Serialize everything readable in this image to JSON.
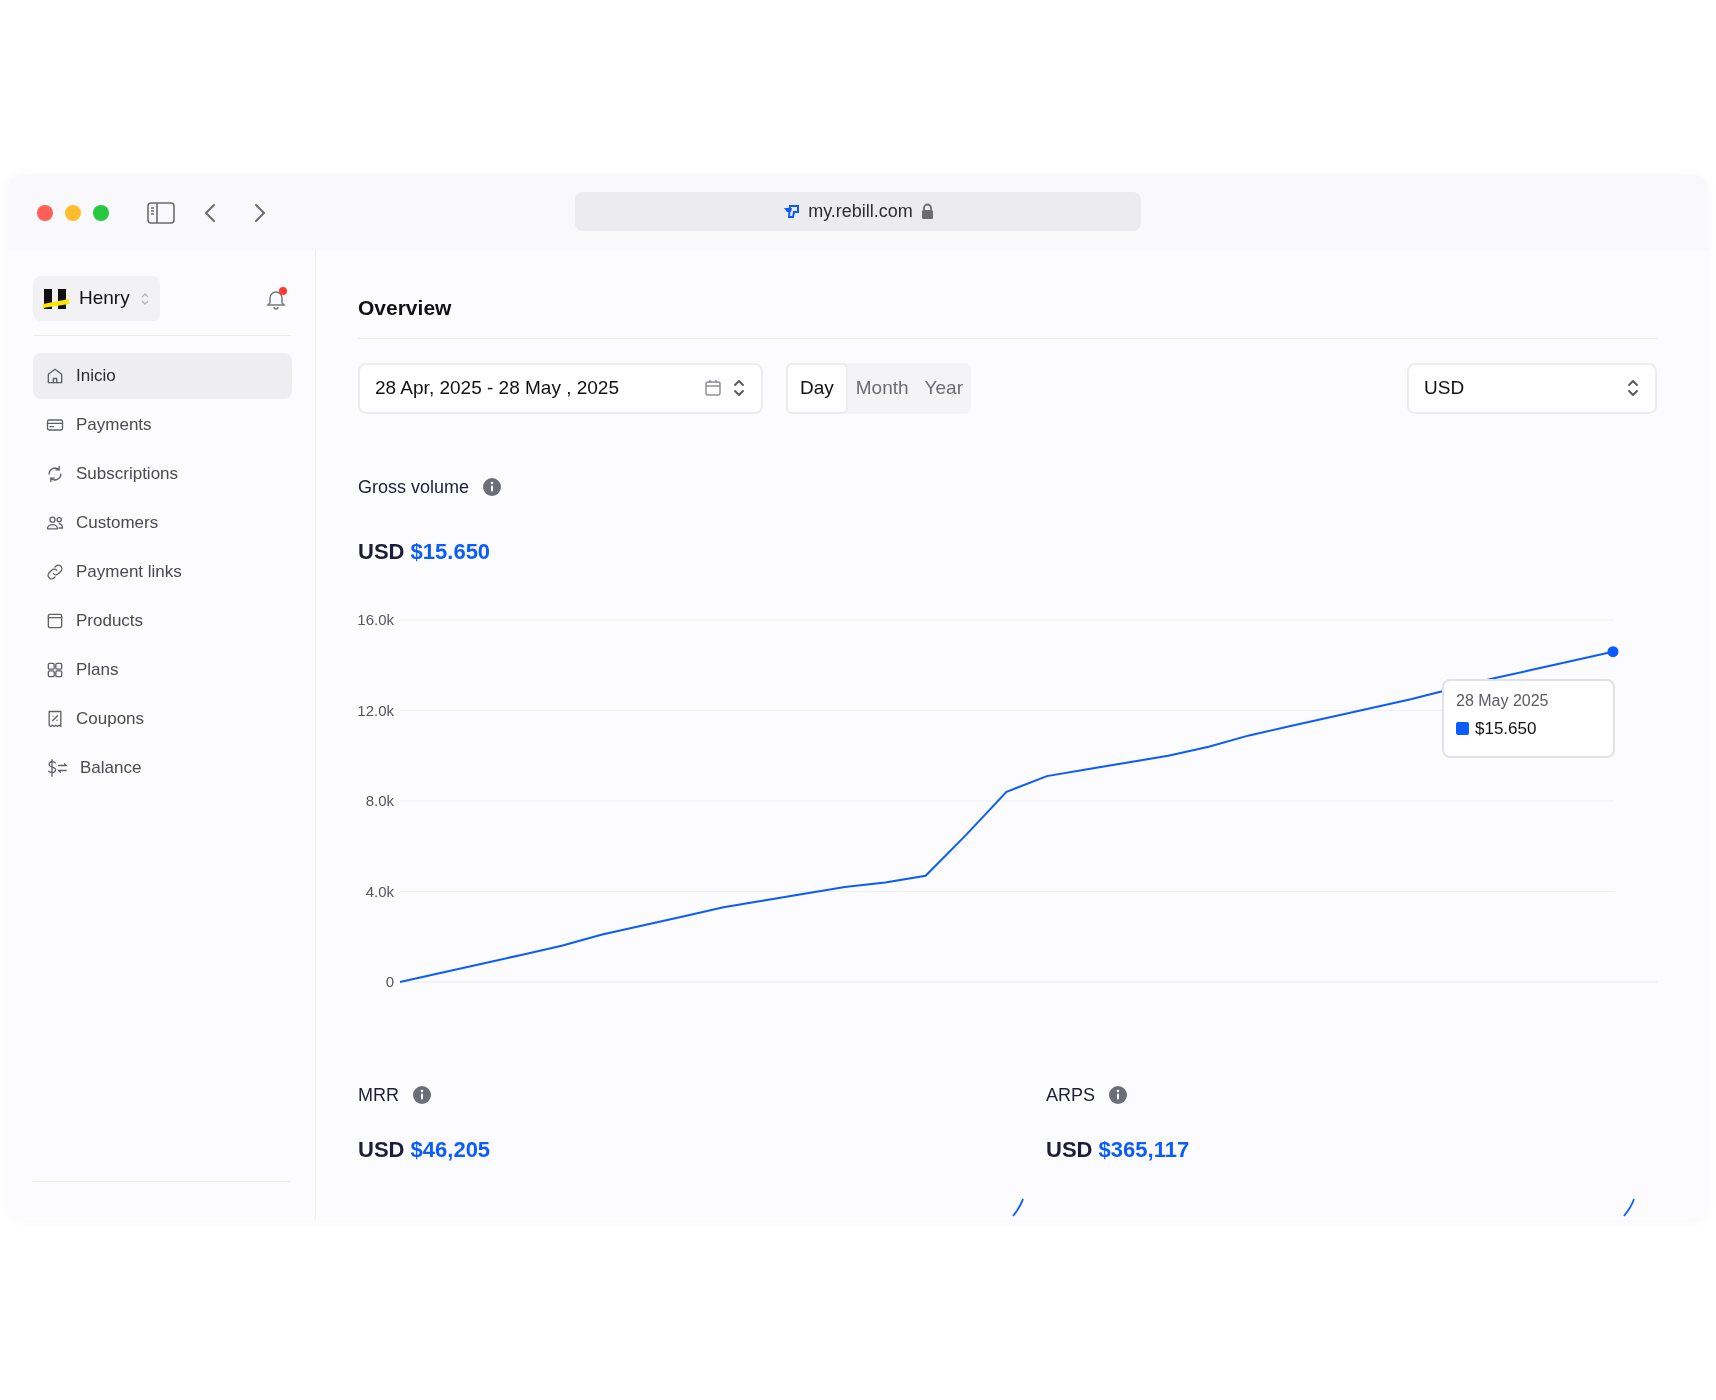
{
  "browser": {
    "url": "my.rebill.com"
  },
  "sidebar": {
    "workspace": "Henry",
    "notifications": true,
    "items": [
      {
        "label": "Inicio",
        "selected": true
      },
      {
        "label": "Payments",
        "selected": false
      },
      {
        "label": "Subscriptions",
        "selected": false
      },
      {
        "label": "Customers",
        "selected": false
      },
      {
        "label": "Payment links",
        "selected": false
      },
      {
        "label": "Products",
        "selected": false
      },
      {
        "label": "Plans",
        "selected": false
      },
      {
        "label": "Coupons",
        "selected": false
      },
      {
        "label": "Balance",
        "selected": false
      }
    ]
  },
  "main": {
    "title": "Overview",
    "date_range": "28 Apr, 2025 - 28 May , 2025",
    "periods": [
      {
        "label": "Day",
        "selected": true
      },
      {
        "label": "Month",
        "selected": false
      },
      {
        "label": "Year",
        "selected": false
      }
    ],
    "currency": "USD",
    "gross_volume": {
      "label": "Gross volume",
      "currency": "USD",
      "amount": "$15.650",
      "tooltip": {
        "date": "28 May 2025",
        "value": "$15.650"
      },
      "chart_data": {
        "type": "line",
        "grid": true,
        "series": [
          {
            "color": "#0a5cff",
            "values": [
              0,
              400,
              800,
              1200,
              1600,
              2100,
              2500,
              2900,
              3300,
              3600,
              3900,
              4200,
              4400,
              4700,
              6500,
              8400,
              9100,
              9400,
              9700,
              10000,
              10400,
              10900,
              11300,
              11700,
              12100,
              12500,
              null,
              13400,
              13800,
              14200,
              14600
            ]
          }
        ],
        "ylim": [
          0,
          16000
        ],
        "yticks": [
          {
            "value": 0,
            "label": "0"
          },
          {
            "value": 4000,
            "label": "4.0k"
          },
          {
            "value": 8000,
            "label": "8.0k"
          },
          {
            "value": 12000,
            "label": "12.0k"
          },
          {
            "value": 16000,
            "label": "16.0k"
          }
        ]
      }
    },
    "metrics": [
      {
        "label": "MRR",
        "currency": "USD",
        "amount": "$46,205"
      },
      {
        "label": "ARPS",
        "currency": "USD",
        "amount": "$365,117"
      }
    ]
  }
}
